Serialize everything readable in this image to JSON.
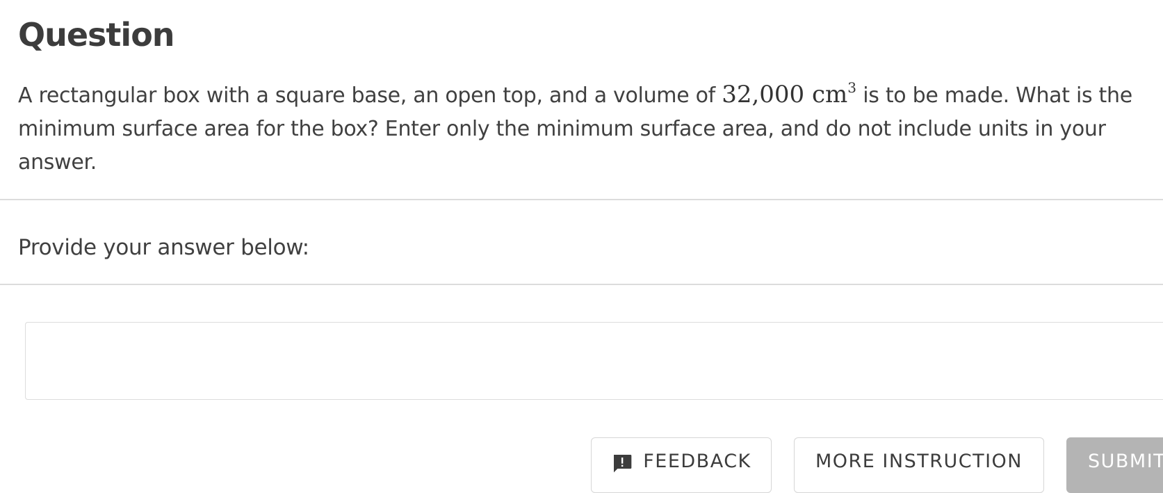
{
  "question": {
    "title": "Question",
    "text_before": "A rectangular box with a square base, an open top, and a volume of ",
    "math_value": "32,000 cm",
    "math_exponent": "3",
    "text_after": " is to be made. What is the minimum surface area for the box? Enter only the minimum surface area, and do not include units in your answer."
  },
  "answer": {
    "prompt": "Provide your answer below:",
    "value": "",
    "placeholder": ""
  },
  "buttons": {
    "feedback_label": "FEEDBACK",
    "feedback_icon": "feedback-icon",
    "more_instruction_label": "MORE INSTRUCTION",
    "submit_label": "SUBMIT"
  },
  "colors": {
    "text": "#404040",
    "divider": "#dcdcdc",
    "submit_disabled": "#b4b4b4"
  }
}
